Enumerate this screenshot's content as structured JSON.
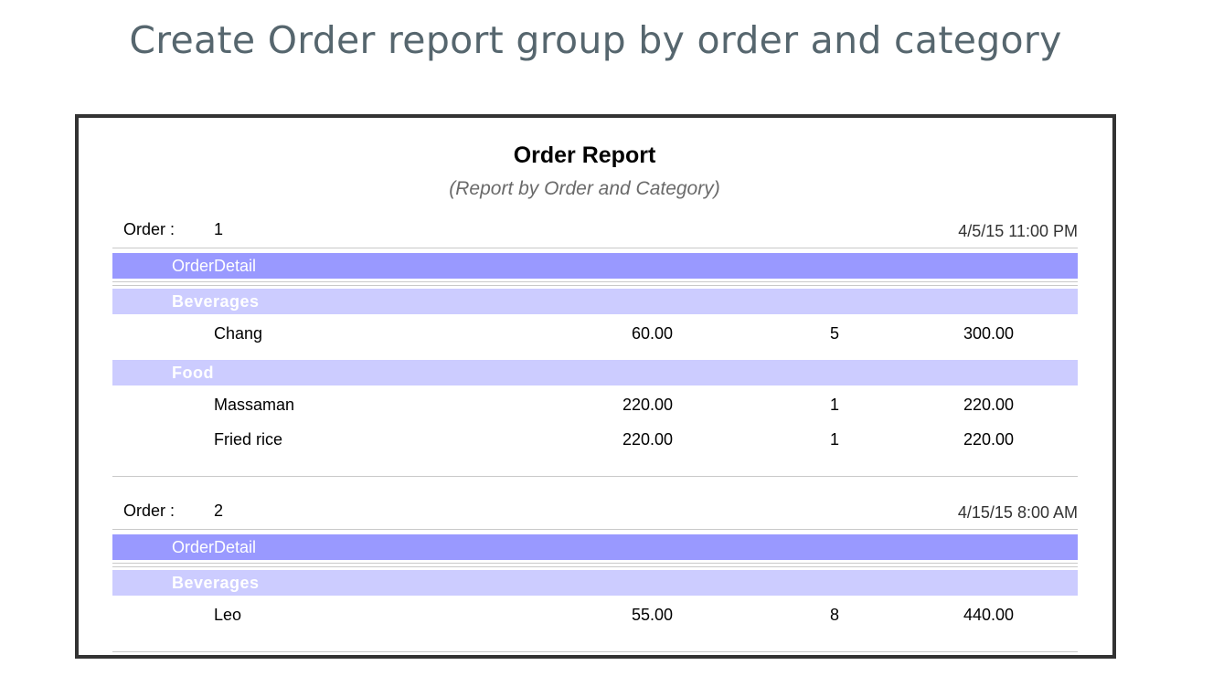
{
  "page": {
    "heading": "Create Order report group by order and category"
  },
  "report": {
    "title": "Order Report",
    "subtitle": "(Report by Order and Category)",
    "order_label": "Order :",
    "detail_band_label": "OrderDetail",
    "orders": [
      {
        "number": "1",
        "date": "4/5/15 11:00 PM",
        "categories": [
          {
            "name": "Beverages",
            "items": [
              {
                "name": "Chang",
                "price": "60.00",
                "qty": "5",
                "total": "300.00"
              }
            ]
          },
          {
            "name": "Food",
            "items": [
              {
                "name": "Massaman",
                "price": "220.00",
                "qty": "1",
                "total": "220.00"
              },
              {
                "name": "Fried rice",
                "price": "220.00",
                "qty": "1",
                "total": "220.00"
              }
            ]
          }
        ]
      },
      {
        "number": "2",
        "date": "4/15/15 8:00 AM",
        "categories": [
          {
            "name": "Beverages",
            "items": [
              {
                "name": "Leo",
                "price": "55.00",
                "qty": "8",
                "total": "440.00"
              }
            ]
          }
        ]
      }
    ]
  },
  "colors": {
    "frame_border": "#333333",
    "detail_band": "#9999ff",
    "category_band": "#ccccff",
    "heading_text": "#56666e"
  }
}
